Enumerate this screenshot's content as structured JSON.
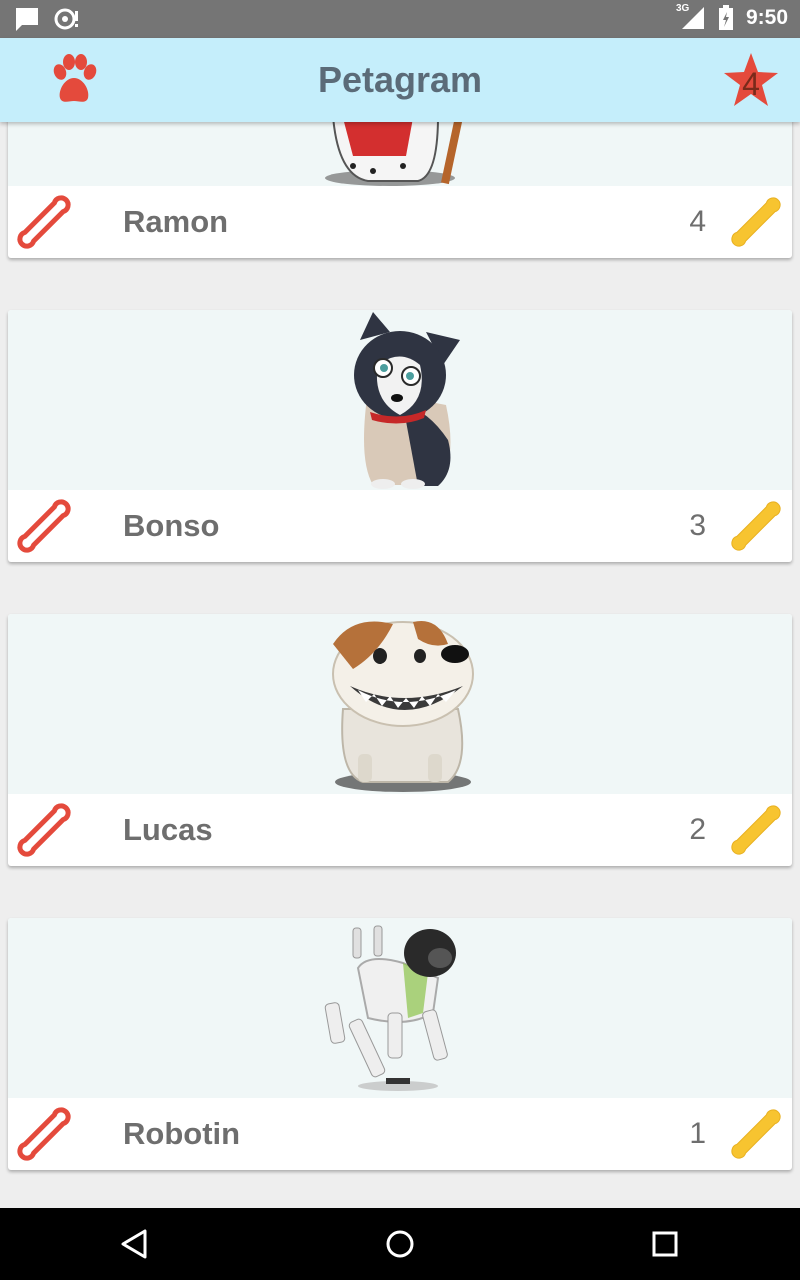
{
  "status_bar": {
    "time": "9:50",
    "network": "3G",
    "icons": [
      "message-icon",
      "sync-alert-icon",
      "signal-icon",
      "battery-icon"
    ]
  },
  "app_bar": {
    "title": "Petagram",
    "left_icon": "paw-icon",
    "right_icon": "star-icon",
    "favorites_count": "4",
    "background": "#c5eefb",
    "accent_red": "#e44a3c"
  },
  "pets": [
    {
      "name": "Ramon",
      "rating": "4",
      "image": "king-dog-illustration"
    },
    {
      "name": "Bonso",
      "rating": "3",
      "image": "husky-puppy-illustration"
    },
    {
      "name": "Lucas",
      "rating": "2",
      "image": "smiling-bulldog-illustration"
    },
    {
      "name": "Robotin",
      "rating": "1",
      "image": "robot-dog-illustration"
    }
  ],
  "colors": {
    "like_bone": "#e44a3c",
    "rating_bone": "#f7c430"
  },
  "nav_bar": {
    "buttons": [
      "back-icon",
      "home-icon",
      "recents-icon"
    ]
  }
}
